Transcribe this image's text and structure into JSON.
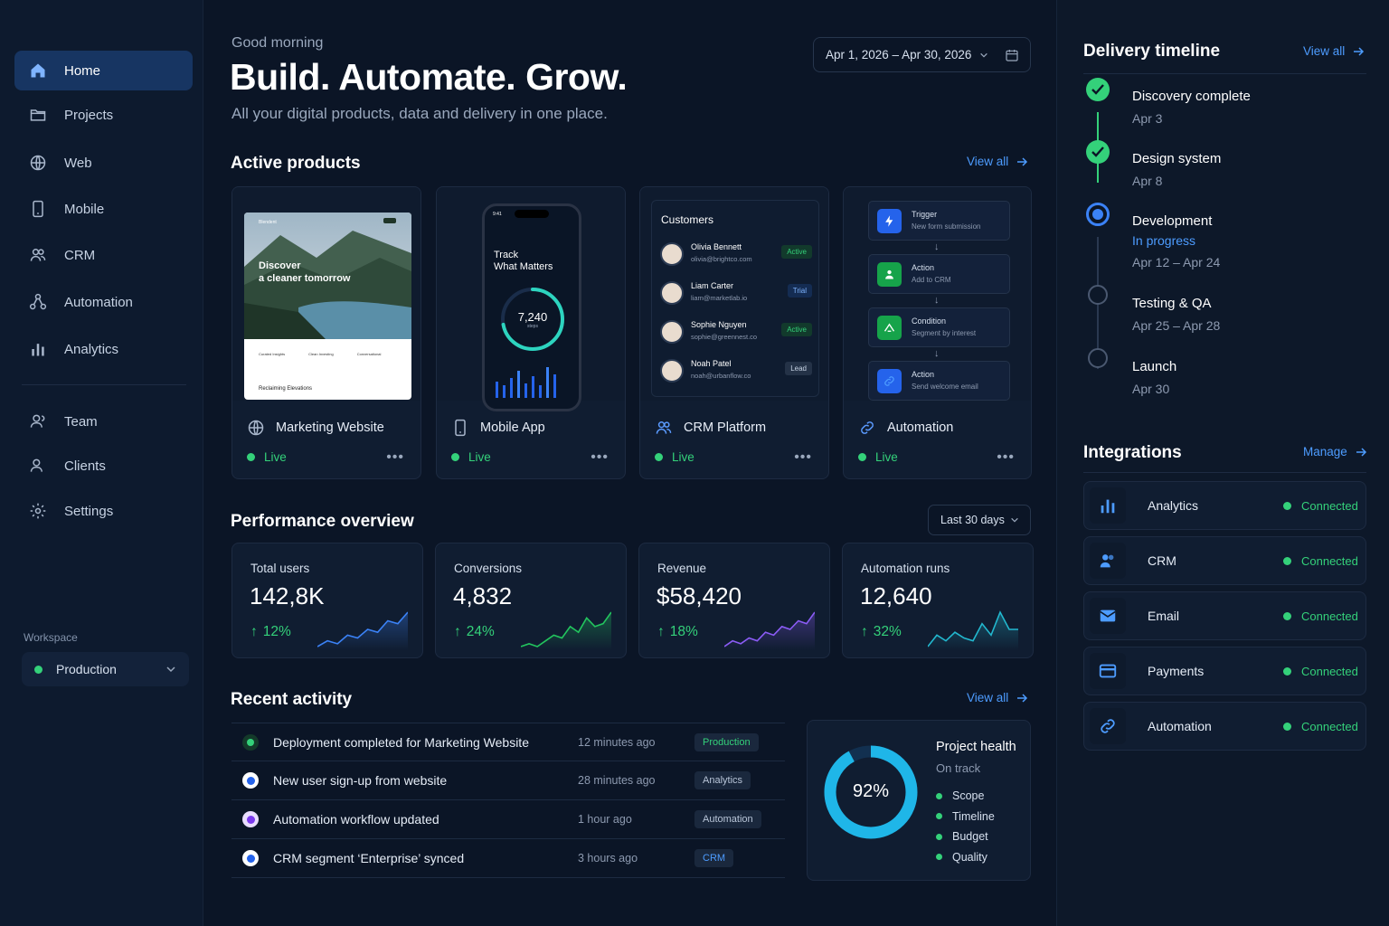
{
  "sidebar": {
    "items": [
      {
        "label": "Home",
        "icon": "home-icon"
      },
      {
        "label": "Projects",
        "icon": "folder-icon"
      },
      {
        "label": "Web",
        "icon": "globe-icon"
      },
      {
        "label": "Mobile",
        "icon": "phone-icon"
      },
      {
        "label": "CRM",
        "icon": "users-icon"
      },
      {
        "label": "Automation",
        "icon": "workflow-icon"
      },
      {
        "label": "Analytics",
        "icon": "bar-chart-icon"
      },
      {
        "label": "Team",
        "icon": "person-icon"
      },
      {
        "label": "Clients",
        "icon": "person-icon"
      },
      {
        "label": "Settings",
        "icon": "gear-icon"
      }
    ],
    "workspace_label": "Workspace",
    "workspace_value": "Production"
  },
  "header": {
    "greeting": "Good morning",
    "title": "Build. Automate. Grow.",
    "subtitle": "All your digital products, data and delivery in one place.",
    "date_range": "Apr 1, 2026 – Apr 30, 2026"
  },
  "products": {
    "title": "Active products",
    "view_all": "View all",
    "items": [
      {
        "name": "Marketing Website",
        "status": "Live",
        "icon": "globe-icon"
      },
      {
        "name": "Mobile App",
        "status": "Live",
        "icon": "phone-icon"
      },
      {
        "name": "CRM Platform",
        "status": "Live",
        "icon": "users-icon"
      },
      {
        "name": "Automation",
        "status": "Live",
        "icon": "link-icon"
      }
    ],
    "website_preview": {
      "brand": "Blendent",
      "headline_1": "Discover",
      "headline_2": "a cleaner tomorrow",
      "footer": "Reclaiming Elevations",
      "cols": [
        "Curated Insights",
        "Clean Investing",
        "Conversational"
      ]
    },
    "phone_preview": {
      "time": "9:41",
      "headline_1": "Track",
      "headline_2": "What Matters",
      "steps": "7,240",
      "steps_label": "steps",
      "ring_progress": 0.72
    },
    "crm_preview": {
      "title": "Customers",
      "rows": [
        {
          "name": "Olivia Bennett",
          "email": "olivia@brightco.com",
          "tag": "Active"
        },
        {
          "name": "Liam Carter",
          "email": "liam@marketlab.io",
          "tag": "Trial"
        },
        {
          "name": "Sophie Nguyen",
          "email": "sophie@greennest.co",
          "tag": "Active"
        },
        {
          "name": "Noah Patel",
          "email": "noah@urbanflow.co",
          "tag": "Lead"
        }
      ]
    },
    "automation_preview": [
      {
        "kind": "Trigger",
        "desc": "New form submission",
        "icon": "bolt-icon"
      },
      {
        "kind": "Action",
        "desc": "Add to CRM",
        "icon": "user-add-icon"
      },
      {
        "kind": "Condition",
        "desc": "Segment by interest",
        "icon": "branch-icon"
      },
      {
        "kind": "Action",
        "desc": "Send welcome email",
        "icon": "link-icon"
      }
    ]
  },
  "performance": {
    "title": "Performance overview",
    "filter": "Last 30 days",
    "cards": [
      {
        "label": "Total users",
        "value": "142,8K",
        "delta": "12%",
        "color": "#3b82f6",
        "trend": [
          2,
          3,
          2.5,
          4,
          3.5,
          5,
          4.5,
          6.5,
          6,
          8
        ]
      },
      {
        "label": "Conversions",
        "value": "4,832",
        "delta": "24%",
        "color": "#22c55e",
        "trend": [
          2,
          2.5,
          2,
          3,
          4,
          3.5,
          5.5,
          4.5,
          7,
          5.5,
          6,
          8
        ]
      },
      {
        "label": "Revenue",
        "value": "$58,420",
        "delta": "18%",
        "color": "#8b5cf6",
        "trend": [
          2,
          3,
          2.5,
          3.5,
          3,
          4.5,
          4,
          5.5,
          5,
          6.5,
          6,
          8
        ]
      },
      {
        "label": "Automation runs",
        "value": "12,640",
        "delta": "32%",
        "color": "#22b8cf",
        "trend": [
          2,
          4,
          3,
          4.5,
          3.5,
          3,
          6,
          4,
          8,
          5,
          5
        ]
      }
    ]
  },
  "activity": {
    "title": "Recent activity",
    "view_all": "View all",
    "rows": [
      {
        "text": "Deployment completed for Marketing Website",
        "time": "12 minutes ago",
        "tag": "Production",
        "kind": "green",
        "tag_color": "#34d17a"
      },
      {
        "text": "New user sign-up from website",
        "time": "28 minutes ago",
        "tag": "Analytics",
        "kind": "blue",
        "tag_color": "#b8c5d8"
      },
      {
        "text": "Automation workflow updated",
        "time": "1 hour ago",
        "tag": "Automation",
        "kind": "purple",
        "tag_color": "#b8c5d8"
      },
      {
        "text": "CRM segment ‘Enterprise’ synced",
        "time": "3 hours ago",
        "tag": "CRM",
        "kind": "blue",
        "tag_color": "#4d9cff"
      }
    ]
  },
  "health": {
    "title": "Project health",
    "status": "On track",
    "percent": "92%",
    "progress": 0.92,
    "items": [
      "Scope",
      "Timeline",
      "Budget",
      "Quality"
    ]
  },
  "timeline": {
    "title": "Delivery timeline",
    "view_all": "View all",
    "steps": [
      {
        "title": "Discovery complete",
        "date": "Apr 3",
        "state": "done"
      },
      {
        "title": "Design system",
        "date": "Apr 8",
        "state": "done"
      },
      {
        "title": "Development",
        "progress": "In progress",
        "date": "Apr 12 – Apr 24",
        "state": "current"
      },
      {
        "title": "Testing & QA",
        "date": "Apr 25 – Apr 28",
        "state": "todo"
      },
      {
        "title": "Launch",
        "date": "Apr 30",
        "state": "todo"
      }
    ]
  },
  "integrations": {
    "title": "Integrations",
    "manage": "Manage",
    "items": [
      {
        "name": "Analytics",
        "status": "Connected",
        "icon": "bar-chart-icon"
      },
      {
        "name": "CRM",
        "status": "Connected",
        "icon": "users-icon"
      },
      {
        "name": "Email",
        "status": "Connected",
        "icon": "mail-icon"
      },
      {
        "name": "Payments",
        "status": "Connected",
        "icon": "card-icon"
      },
      {
        "name": "Automation",
        "status": "Connected",
        "icon": "link-icon"
      }
    ]
  }
}
